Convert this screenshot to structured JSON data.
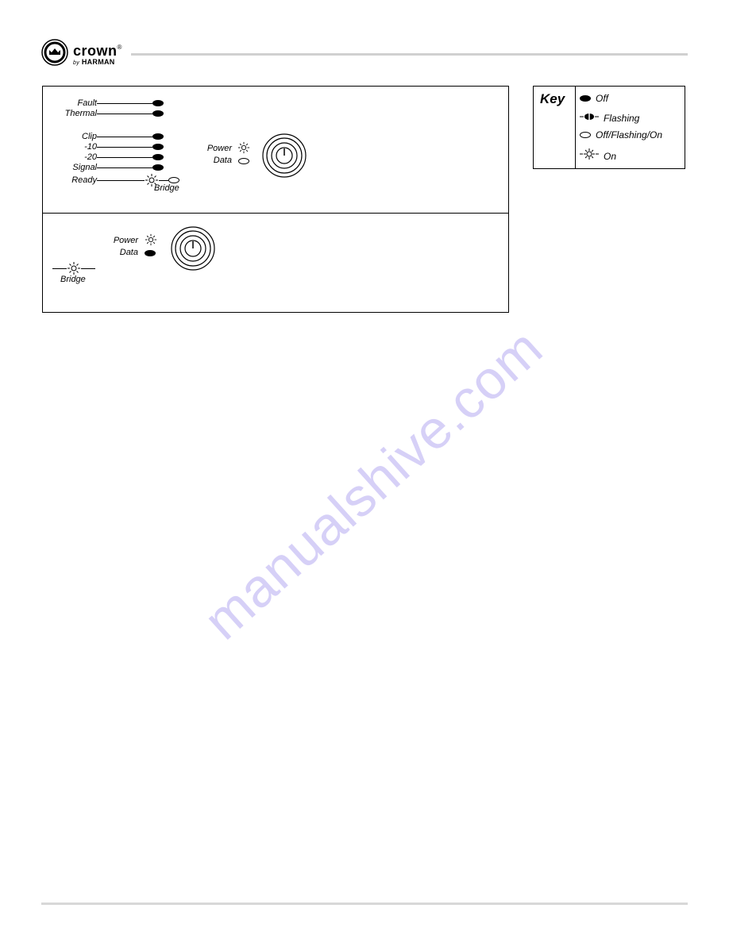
{
  "brand": {
    "main": "crown",
    "sub_prefix": "by",
    "sub": "HARMAN",
    "reg": "®"
  },
  "panel_top": {
    "indicators": [
      "Fault",
      "Thermal",
      "Clip",
      "-10",
      "-20",
      "Signal",
      "Ready"
    ],
    "power_label": "Power",
    "data_label": "Data",
    "bridge_label": "Bridge"
  },
  "panel_bottom": {
    "power_label": "Power",
    "data_label": "Data",
    "bridge_label": "Bridge"
  },
  "key": {
    "title": "Key",
    "items": [
      {
        "label": "Off"
      },
      {
        "label": "Flashing"
      },
      {
        "label": "Off/Flashing/On"
      },
      {
        "label": "On"
      }
    ]
  },
  "watermark": "manualshive.com"
}
